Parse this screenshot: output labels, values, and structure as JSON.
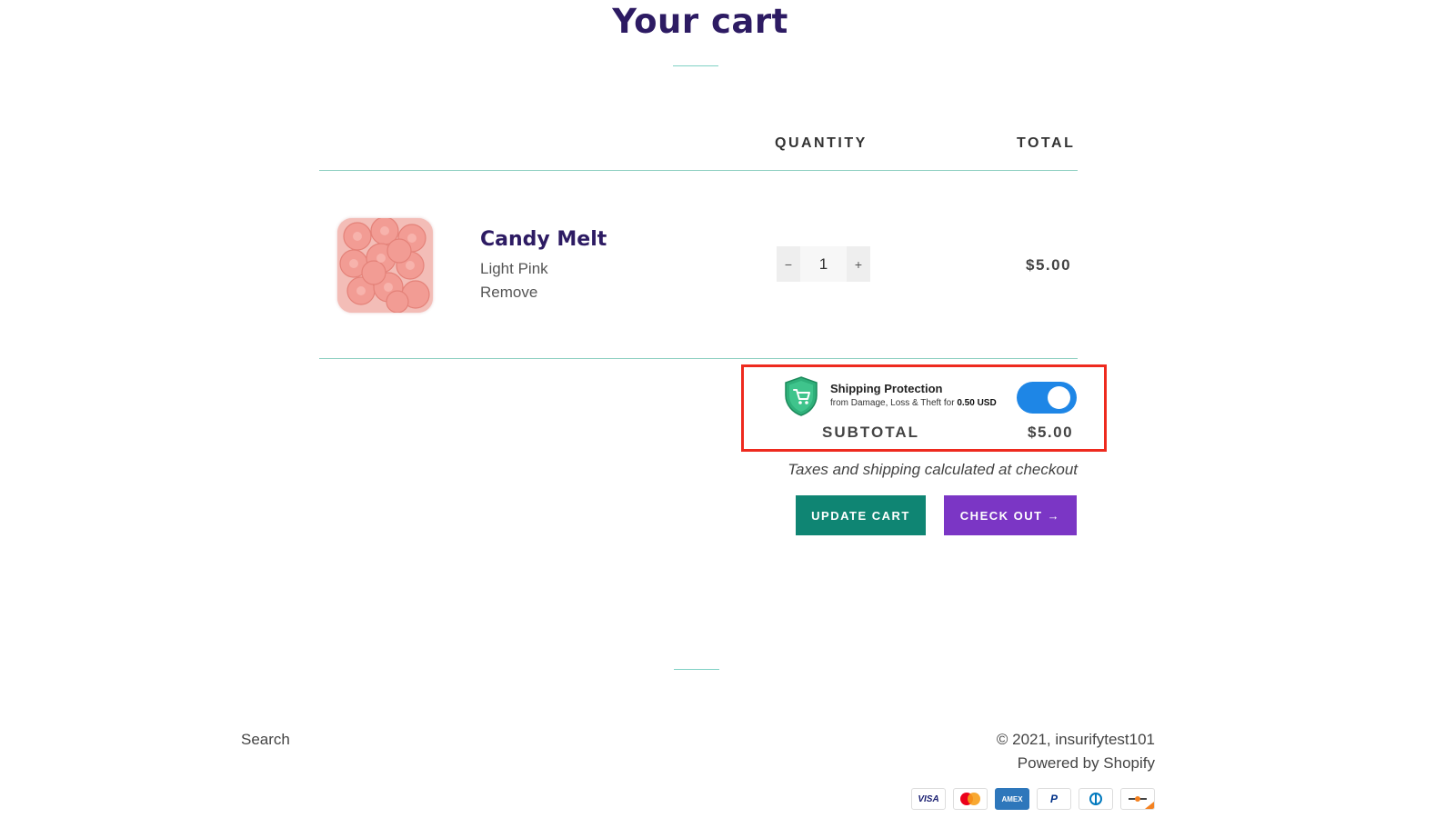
{
  "page": {
    "title": "Your cart"
  },
  "table": {
    "headers": {
      "quantity": "QUANTITY",
      "total": "TOTAL"
    }
  },
  "item": {
    "name": "Candy Melt",
    "variant": "Light Pink",
    "remove_label": "Remove",
    "quantity": "1",
    "minus_label": "−",
    "plus_label": "+",
    "total": "$5.00",
    "image_icon": "candy-melt-product-photo"
  },
  "protection": {
    "title": "Shipping Protection",
    "subtitle": "from Damage, Loss & Theft for",
    "price": "0.50 USD",
    "enabled": true,
    "icon": "shield-cart-icon",
    "accent": "#1e86e6"
  },
  "summary": {
    "subtotal_label": "SUBTOTAL",
    "subtotal_value": "$5.00",
    "tax_note": "Taxes and shipping calculated at checkout"
  },
  "actions": {
    "update_label": "UPDATE CART",
    "checkout_label": "CHECK OUT →"
  },
  "footer": {
    "search_label": "Search",
    "copyright": "© 2021, insurifytest101",
    "powered": "Powered by Shopify",
    "payments": [
      {
        "name": "visa-icon",
        "label": "VISA"
      },
      {
        "name": "mastercard-icon",
        "label": ""
      },
      {
        "name": "amex-icon",
        "label": "AMEX"
      },
      {
        "name": "paypal-icon",
        "label": "P"
      },
      {
        "name": "diners-icon",
        "label": ""
      },
      {
        "name": "discover-icon",
        "label": ""
      }
    ]
  },
  "colors": {
    "title": "#2d1b63",
    "update_button": "#0f8573",
    "checkout_button": "#7b36c5",
    "highlight": "#ee2a1e",
    "divider": "#8ccfc0"
  }
}
